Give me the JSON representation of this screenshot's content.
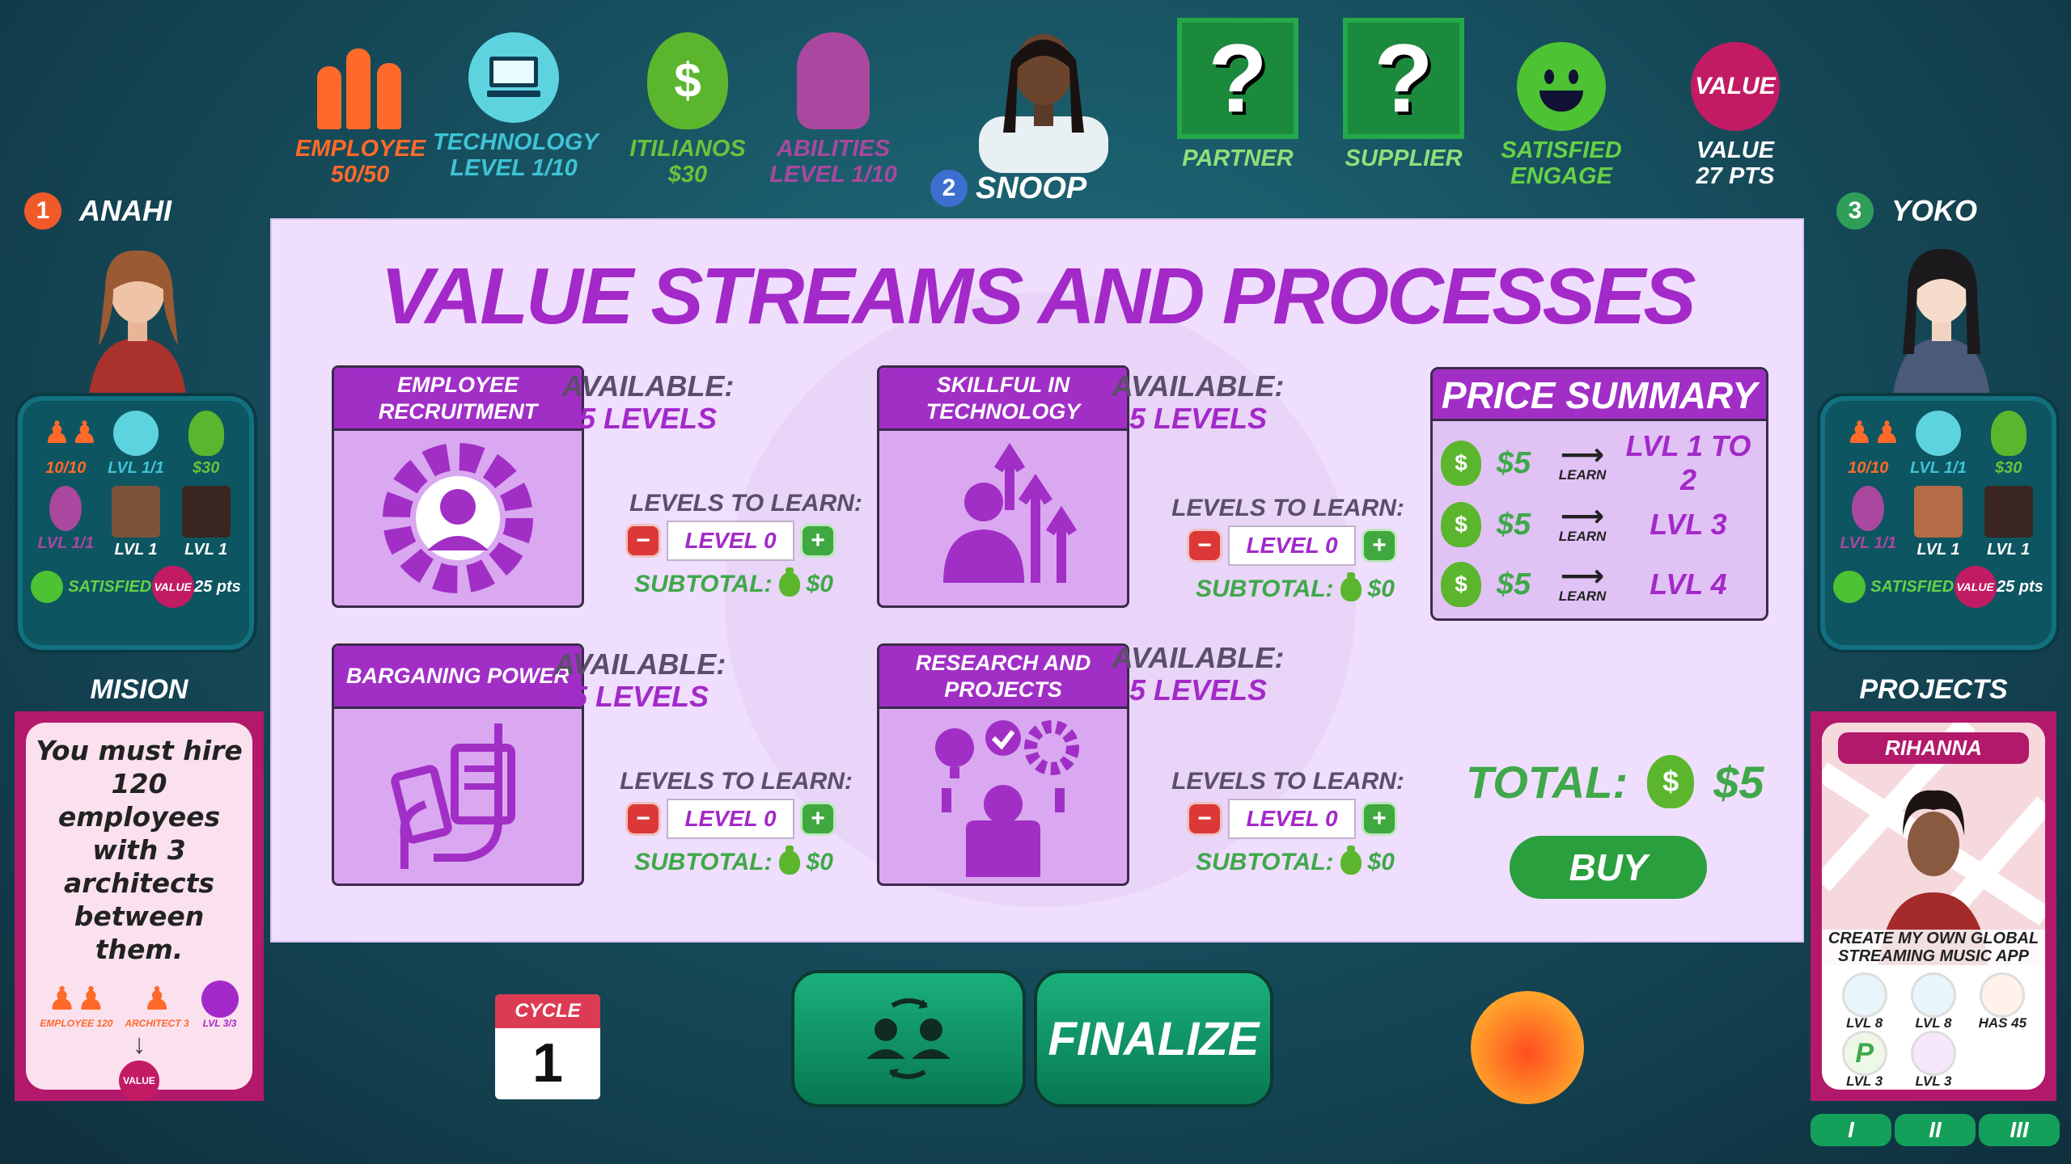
{
  "top_stats": {
    "employee": {
      "label": "EMPLOYEE",
      "value": "50/50"
    },
    "technology": {
      "label": "TECHNOLOGY",
      "value": "LEVEL 1/10"
    },
    "itilianos": {
      "label": "ITILIANOS",
      "value": "$30"
    },
    "abilities": {
      "label": "ABILITIES",
      "value": "LEVEL 1/10"
    },
    "partner": {
      "label": "PARTNER"
    },
    "supplier": {
      "label": "SUPPLIER"
    },
    "satisfied": {
      "line1": "SATISFIED",
      "line2": "ENGAGE"
    },
    "value": {
      "badge": "VALUE",
      "line1": "VALUE",
      "line2": "27 PTS"
    }
  },
  "players": {
    "center": {
      "number": "2",
      "name": "SNOOP"
    },
    "left": {
      "number": "1",
      "name": "ANAHI"
    },
    "right": {
      "number": "3",
      "name": "YOKO"
    }
  },
  "left_card": {
    "cells": [
      {
        "label": "10/10"
      },
      {
        "label": "LVL 1/1"
      },
      {
        "label": "$30"
      },
      {
        "label": "LVL 1/1"
      },
      {
        "label": "LVL 1"
      },
      {
        "label": "LVL 1"
      }
    ],
    "satisfied": "SATISFIED",
    "value_badge": "VALUE",
    "pts": "25 pts"
  },
  "right_card": {
    "cells": [
      {
        "label": "10/10"
      },
      {
        "label": "LVL 1/1"
      },
      {
        "label": "$30"
      },
      {
        "label": "LVL 1/1"
      },
      {
        "label": "LVL 1"
      },
      {
        "label": "LVL 1"
      }
    ],
    "satisfied": "SATISFIED",
    "value_badge": "VALUE",
    "pts": "25 pts"
  },
  "mission": {
    "title": "MISION",
    "text": "You must hire 120 employees with 3 architects between them.",
    "emp_label": "EMPLOYEE 120",
    "arch_label": "ARCHITECT 3",
    "lvl_label": "LVL 3/3",
    "value_badge": "VALUE"
  },
  "projects": {
    "title": "PROJECTS",
    "name": "RIHANNA",
    "goal": "CREATE MY OWN GLOBAL STREAMING MUSIC APP",
    "reqs": [
      "LVL 8",
      "LVL 8",
      "HAS 45",
      "LVL 3",
      "LVL 3"
    ],
    "pages": [
      "I",
      "II",
      "III"
    ]
  },
  "panel": {
    "title": "VALUE STREAMS AND PROCESSES",
    "available_label": "AVAILABLE:",
    "levels_to_learn_label": "LEVELS TO LEARN:",
    "subtotal_label": "SUBTOTAL:",
    "skills": [
      {
        "name": "EMPLOYEE RECRUITMENT",
        "available": "5 LEVELS",
        "level": "LEVEL 0",
        "subtotal": "$0"
      },
      {
        "name": "SKILLFUL IN TECHNOLOGY",
        "available": "5 LEVELS",
        "level": "LEVEL 0",
        "subtotal": "$0"
      },
      {
        "name": "BARGANING POWER",
        "available": "5 LEVELS",
        "level": "LEVEL 0",
        "subtotal": "$0"
      },
      {
        "name": "RESEARCH AND PROJECTS",
        "available": "5 LEVELS",
        "level": "LEVEL 0",
        "subtotal": "$0"
      }
    ],
    "price_summary": {
      "title": "PRICE SUMMARY",
      "learn_label": "LEARN",
      "rows": [
        {
          "amount": "$5",
          "target": "LVL 1 TO 2"
        },
        {
          "amount": "$5",
          "target": "LVL 3"
        },
        {
          "amount": "$5",
          "target": "LVL 4"
        }
      ]
    },
    "total_label": "TOTAL:",
    "total_value": "$5",
    "buy_label": "BUY"
  },
  "cycle": {
    "label": "CYCLE",
    "number": "1"
  },
  "finalize_label": "FINALIZE",
  "colors": {
    "accent_purple": "#a329c9",
    "money_green": "#3fa84a",
    "employee_orange": "#ff6a2a",
    "tech_cyan": "#3fc3d6",
    "value_magenta": "#c21b64"
  }
}
